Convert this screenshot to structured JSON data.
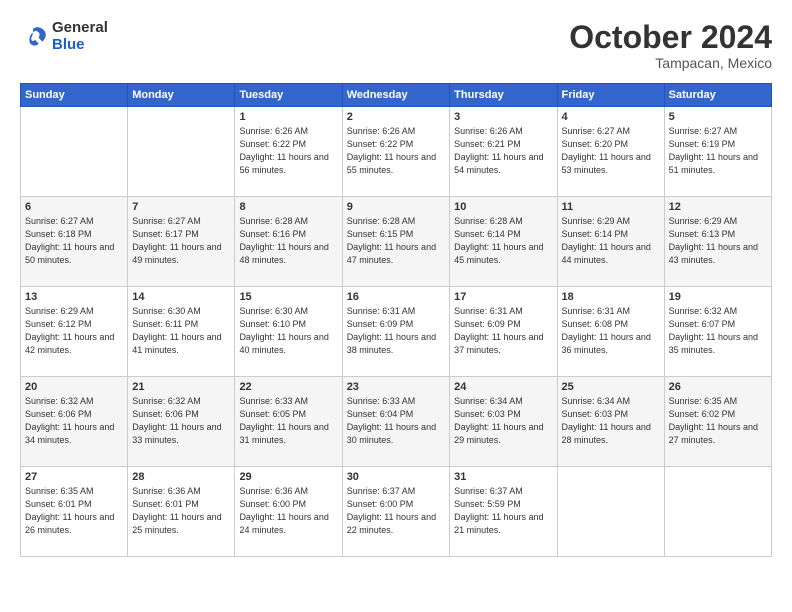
{
  "header": {
    "logo_general": "General",
    "logo_blue": "Blue",
    "month_title": "October 2024",
    "location": "Tampacan, Mexico"
  },
  "calendar": {
    "headers": [
      "Sunday",
      "Monday",
      "Tuesday",
      "Wednesday",
      "Thursday",
      "Friday",
      "Saturday"
    ],
    "weeks": [
      [
        {
          "day": "",
          "info": ""
        },
        {
          "day": "",
          "info": ""
        },
        {
          "day": "1",
          "info": "Sunrise: 6:26 AM\nSunset: 6:22 PM\nDaylight: 11 hours and 56 minutes."
        },
        {
          "day": "2",
          "info": "Sunrise: 6:26 AM\nSunset: 6:22 PM\nDaylight: 11 hours and 55 minutes."
        },
        {
          "day": "3",
          "info": "Sunrise: 6:26 AM\nSunset: 6:21 PM\nDaylight: 11 hours and 54 minutes."
        },
        {
          "day": "4",
          "info": "Sunrise: 6:27 AM\nSunset: 6:20 PM\nDaylight: 11 hours and 53 minutes."
        },
        {
          "day": "5",
          "info": "Sunrise: 6:27 AM\nSunset: 6:19 PM\nDaylight: 11 hours and 51 minutes."
        }
      ],
      [
        {
          "day": "6",
          "info": "Sunrise: 6:27 AM\nSunset: 6:18 PM\nDaylight: 11 hours and 50 minutes."
        },
        {
          "day": "7",
          "info": "Sunrise: 6:27 AM\nSunset: 6:17 PM\nDaylight: 11 hours and 49 minutes."
        },
        {
          "day": "8",
          "info": "Sunrise: 6:28 AM\nSunset: 6:16 PM\nDaylight: 11 hours and 48 minutes."
        },
        {
          "day": "9",
          "info": "Sunrise: 6:28 AM\nSunset: 6:15 PM\nDaylight: 11 hours and 47 minutes."
        },
        {
          "day": "10",
          "info": "Sunrise: 6:28 AM\nSunset: 6:14 PM\nDaylight: 11 hours and 45 minutes."
        },
        {
          "day": "11",
          "info": "Sunrise: 6:29 AM\nSunset: 6:14 PM\nDaylight: 11 hours and 44 minutes."
        },
        {
          "day": "12",
          "info": "Sunrise: 6:29 AM\nSunset: 6:13 PM\nDaylight: 11 hours and 43 minutes."
        }
      ],
      [
        {
          "day": "13",
          "info": "Sunrise: 6:29 AM\nSunset: 6:12 PM\nDaylight: 11 hours and 42 minutes."
        },
        {
          "day": "14",
          "info": "Sunrise: 6:30 AM\nSunset: 6:11 PM\nDaylight: 11 hours and 41 minutes."
        },
        {
          "day": "15",
          "info": "Sunrise: 6:30 AM\nSunset: 6:10 PM\nDaylight: 11 hours and 40 minutes."
        },
        {
          "day": "16",
          "info": "Sunrise: 6:31 AM\nSunset: 6:09 PM\nDaylight: 11 hours and 38 minutes."
        },
        {
          "day": "17",
          "info": "Sunrise: 6:31 AM\nSunset: 6:09 PM\nDaylight: 11 hours and 37 minutes."
        },
        {
          "day": "18",
          "info": "Sunrise: 6:31 AM\nSunset: 6:08 PM\nDaylight: 11 hours and 36 minutes."
        },
        {
          "day": "19",
          "info": "Sunrise: 6:32 AM\nSunset: 6:07 PM\nDaylight: 11 hours and 35 minutes."
        }
      ],
      [
        {
          "day": "20",
          "info": "Sunrise: 6:32 AM\nSunset: 6:06 PM\nDaylight: 11 hours and 34 minutes."
        },
        {
          "day": "21",
          "info": "Sunrise: 6:32 AM\nSunset: 6:06 PM\nDaylight: 11 hours and 33 minutes."
        },
        {
          "day": "22",
          "info": "Sunrise: 6:33 AM\nSunset: 6:05 PM\nDaylight: 11 hours and 31 minutes."
        },
        {
          "day": "23",
          "info": "Sunrise: 6:33 AM\nSunset: 6:04 PM\nDaylight: 11 hours and 30 minutes."
        },
        {
          "day": "24",
          "info": "Sunrise: 6:34 AM\nSunset: 6:03 PM\nDaylight: 11 hours and 29 minutes."
        },
        {
          "day": "25",
          "info": "Sunrise: 6:34 AM\nSunset: 6:03 PM\nDaylight: 11 hours and 28 minutes."
        },
        {
          "day": "26",
          "info": "Sunrise: 6:35 AM\nSunset: 6:02 PM\nDaylight: 11 hours and 27 minutes."
        }
      ],
      [
        {
          "day": "27",
          "info": "Sunrise: 6:35 AM\nSunset: 6:01 PM\nDaylight: 11 hours and 26 minutes."
        },
        {
          "day": "28",
          "info": "Sunrise: 6:36 AM\nSunset: 6:01 PM\nDaylight: 11 hours and 25 minutes."
        },
        {
          "day": "29",
          "info": "Sunrise: 6:36 AM\nSunset: 6:00 PM\nDaylight: 11 hours and 24 minutes."
        },
        {
          "day": "30",
          "info": "Sunrise: 6:37 AM\nSunset: 6:00 PM\nDaylight: 11 hours and 22 minutes."
        },
        {
          "day": "31",
          "info": "Sunrise: 6:37 AM\nSunset: 5:59 PM\nDaylight: 11 hours and 21 minutes."
        },
        {
          "day": "",
          "info": ""
        },
        {
          "day": "",
          "info": ""
        }
      ]
    ]
  }
}
